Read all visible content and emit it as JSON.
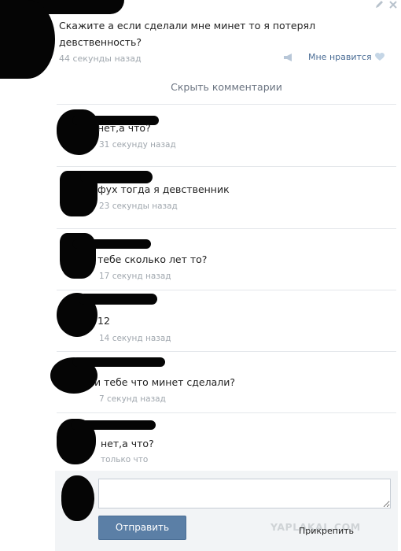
{
  "post": {
    "text": "Скажите а если сделали мне минет то я потерял девственность?",
    "time": "44 секунды назад",
    "like_label": "Мне нравится"
  },
  "comments_header": {
    "hide_label": "Скрыть комментарии"
  },
  "comments": [
    {
      "text": "нет,а что?",
      "time": "31 секунду назад"
    },
    {
      "text": "фух тогда я девственник",
      "time": "23 секунды назад"
    },
    {
      "text": "тебе сколько лет то?",
      "time": "17 секунд назад"
    },
    {
      "text": "12",
      "time": "14 секунд назад"
    },
    {
      "text": "и тебе что минет сделали?",
      "time": "7 секунд назад"
    },
    {
      "text": "нет,а что?",
      "time": "только что"
    }
  ],
  "reply": {
    "input_value": "",
    "send_label": "Отправить",
    "attach_label": "Прикрепить"
  },
  "watermark": "YAPLAKAL.COM",
  "colors": {
    "link": "#4c6e96",
    "button": "#5b7fa6",
    "muted": "#a0a7ae"
  },
  "icons": [
    "pencil-icon",
    "close-icon",
    "megaphone-icon",
    "heart-icon"
  ]
}
